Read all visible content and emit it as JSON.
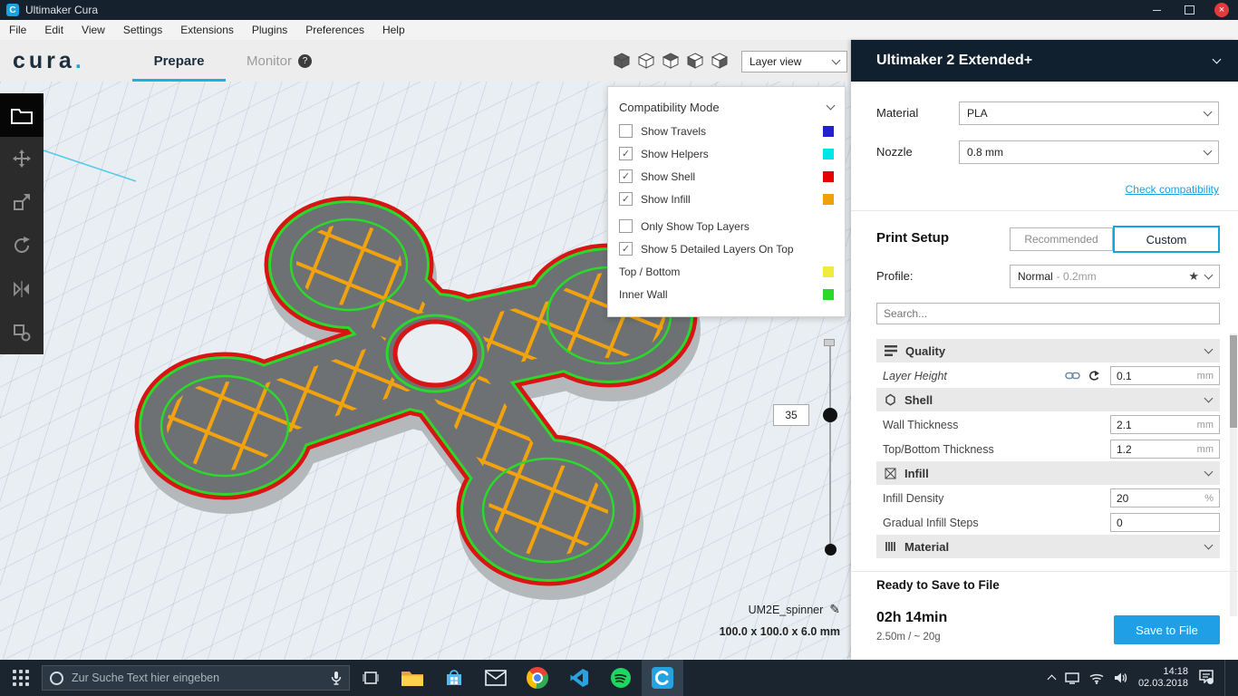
{
  "title_bar": {
    "title": "Ultimaker Cura"
  },
  "menu": {
    "items": [
      "File",
      "Edit",
      "View",
      "Settings",
      "Extensions",
      "Plugins",
      "Preferences",
      "Help"
    ]
  },
  "header": {
    "logo_text": "cura",
    "logo_dot": ".",
    "tab_prepare": "Prepare",
    "tab_monitor": "Monitor",
    "monitor_badge": "?",
    "view_dropdown": "Layer view"
  },
  "compat_panel": {
    "title": "Compatibility Mode",
    "rows": [
      {
        "label": "Show Travels",
        "checked": false,
        "swatch": "#2222cc"
      },
      {
        "label": "Show Helpers",
        "checked": true,
        "swatch": "#00e6e6"
      },
      {
        "label": "Show Shell",
        "checked": true,
        "swatch": "#e60000"
      },
      {
        "label": "Show Infill",
        "checked": true,
        "swatch": "#f0a10a"
      },
      {
        "label": "Only Show Top Layers",
        "checked": false
      },
      {
        "label": "Show 5 Detailed Layers On Top",
        "checked": true
      }
    ],
    "legend": [
      {
        "label": "Top / Bottom",
        "swatch": "#f0eb3c"
      },
      {
        "label": "Inner Wall",
        "swatch": "#2bd92b"
      }
    ]
  },
  "viewport": {
    "slider_value": "35",
    "model_name": "UM2E_spinner",
    "model_dimensions": "100.0 x 100.0 x 6.0 mm"
  },
  "sidebar": {
    "machine_name": "Ultimaker 2 Extended+",
    "material_label": "Material",
    "material_value": "PLA",
    "nozzle_label": "Nozzle",
    "nozzle_value": "0.8 mm",
    "check_link": "Check compatibility",
    "print_setup": "Print Setup",
    "btn_recommended": "Recommended",
    "btn_custom": "Custom",
    "profile_label": "Profile:",
    "profile_value": "Normal",
    "profile_detail": "- 0.2mm",
    "search_placeholder": "Search...",
    "sections": {
      "quality": {
        "title": "Quality"
      },
      "shell": {
        "title": "Shell"
      },
      "infill": {
        "title": "Infill"
      },
      "material": {
        "title": "Material"
      }
    },
    "settings": {
      "layer_height": {
        "label": "Layer Height",
        "value": "0.1",
        "unit": "mm"
      },
      "wall_thickness": {
        "label": "Wall Thickness",
        "value": "2.1",
        "unit": "mm"
      },
      "top_bottom_thickness": {
        "label": "Top/Bottom Thickness",
        "value": "1.2",
        "unit": "mm"
      },
      "infill_density": {
        "label": "Infill Density",
        "value": "20",
        "unit": "%"
      },
      "gradual_infill": {
        "label": "Gradual Infill Steps",
        "value": "0",
        "unit": ""
      }
    },
    "footer": {
      "status": "Ready to Save to File",
      "print_time": "02h 14min",
      "material_usage": "2.50m / ~ 20g",
      "save_button": "Save to File"
    }
  },
  "taskbar": {
    "search_placeholder": "Zur Suche Text hier eingeben",
    "clock_time": "14:18",
    "clock_date": "02.03.2018"
  },
  "icons": {
    "star": "★",
    "pencil": "✎"
  },
  "colors": {
    "accent_blue": "#18a2df",
    "shell_red": "#d81414",
    "infill_orange": "#f2a20c",
    "inner_wall_green": "#2bd92b",
    "top_bottom_yellow": "#f0eb3c"
  }
}
